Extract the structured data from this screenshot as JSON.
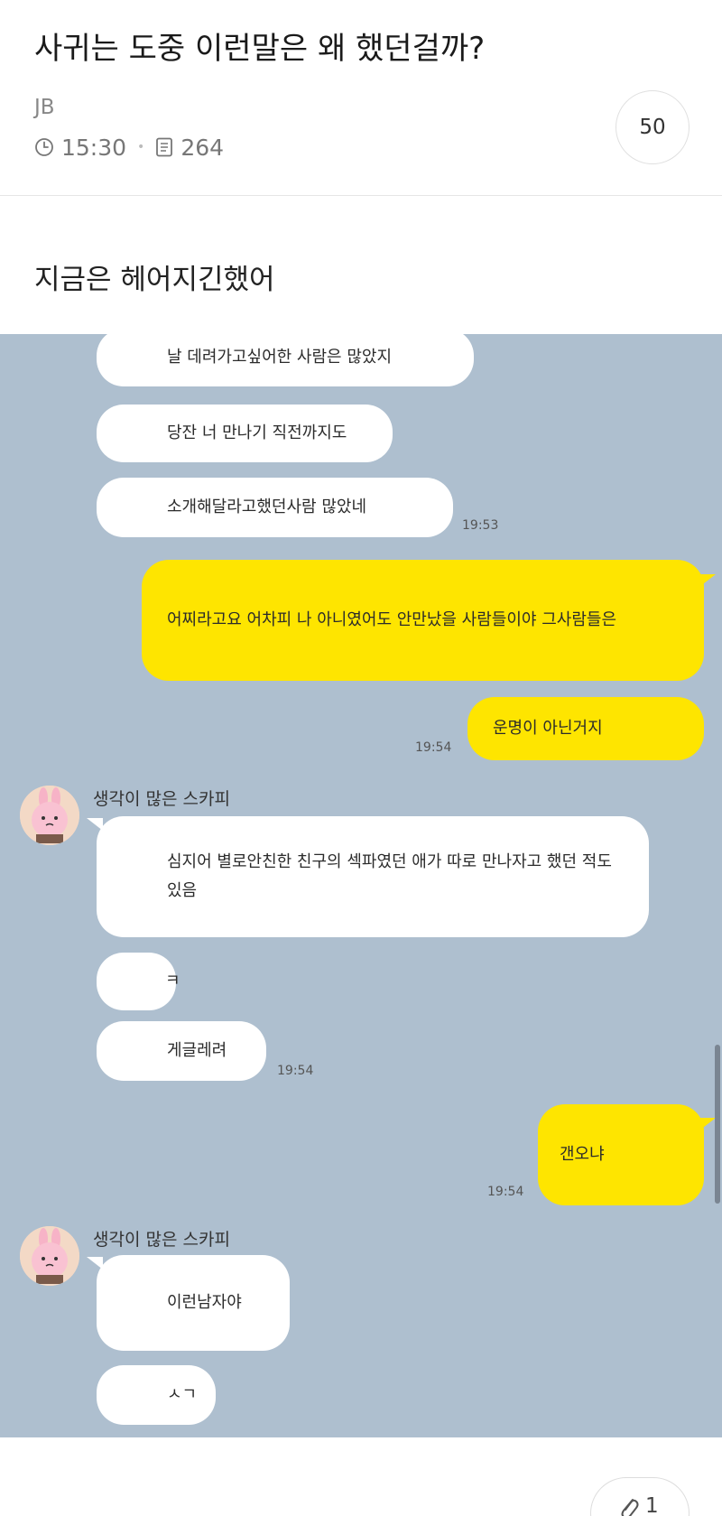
{
  "post": {
    "title": "사귀는 도중 이런말은 왜 했던걸까?",
    "author": "JB",
    "time": "15:30",
    "views": "264",
    "comment_count": "50",
    "body_text": "지금은 헤어지긴했어"
  },
  "chat": {
    "messages": [
      {
        "sender": "other",
        "text": "날 데려가고싶어한 사람은 많았지"
      },
      {
        "sender": "other",
        "text": "당잔 너 만나기 직전까지도"
      },
      {
        "sender": "other",
        "text": "소개해달라고했던사람 많았네",
        "time": "19:53"
      },
      {
        "sender": "me",
        "text": "어찌라고요 어차피 나 아니였어도 안만났을 사람들이야 그사람들은"
      },
      {
        "sender": "me",
        "text": "운명이 아닌거지",
        "time": "19:54"
      },
      {
        "sender": "other",
        "nickname": "생각이 많은 스카피",
        "text": "심지어 별로안친한 친구의 섹파였던 애가 따로 만나자고 했던 적도 있음"
      },
      {
        "sender": "other",
        "text": "ㅋ"
      },
      {
        "sender": "other",
        "text": "게글레려",
        "time": "19:54"
      },
      {
        "sender": "me",
        "text": "갠오냐",
        "time": "19:54"
      },
      {
        "sender": "other",
        "nickname": "생각이 많은 스카피",
        "text": "이런남자야"
      },
      {
        "sender": "other",
        "text": "ㅅㄱ"
      }
    ]
  },
  "footer": {
    "attachment_count": "1"
  },
  "colors": {
    "chat_background": "#aebfcf",
    "my_bubble": "#fee500",
    "other_bubble": "#ffffff"
  },
  "icons": [
    "clock-icon",
    "document-icon",
    "avatar-bunny-icon",
    "paperclip-icon"
  ]
}
